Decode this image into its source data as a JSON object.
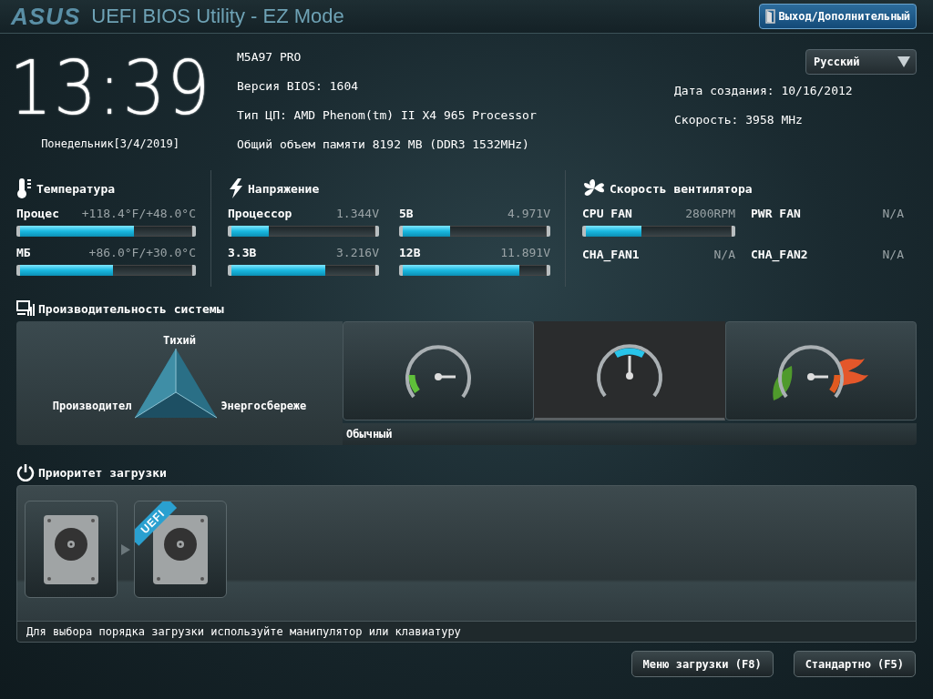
{
  "header": {
    "logo": "ASUS",
    "title": "UEFI BIOS Utility - EZ Mode",
    "exit_button": "Выход/Дополнительный"
  },
  "clock": {
    "time": "13:39",
    "date": "Понедельник[3/4/2019]"
  },
  "system_info": {
    "left": [
      "M5A97 PRO",
      "Версия BIOS: 1604",
      "Тип ЦП: AMD Phenom(tm) II X4 965 Processor",
      "Общий объем памяти 8192 MB (DDR3 1532MHz)"
    ],
    "right": [
      "Дата создания: 10/16/2012",
      "Скорость: 3958 MHz"
    ]
  },
  "language": {
    "value": "Русский"
  },
  "temperature": {
    "title": "Температура",
    "sensors": [
      {
        "name": "Процес",
        "reading": "+118.4°F/+48.0°C",
        "level": 0.66
      },
      {
        "name": "МБ",
        "reading": "+86.0°F/+30.0°C",
        "level": 0.54
      }
    ]
  },
  "voltage": {
    "title": "Напряжение",
    "sensors": [
      {
        "name": "Процессор",
        "reading": "1.344V",
        "level": 0.26
      },
      {
        "name": "5В",
        "reading": "4.971V",
        "level": 0.33
      },
      {
        "name": "3.3В",
        "reading": "3.216V",
        "level": 0.65
      },
      {
        "name": "12В",
        "reading": "11.891V",
        "level": 0.81
      }
    ]
  },
  "fans": {
    "title": "Скорость вентилятора",
    "sensors": [
      {
        "name": "CPU FAN",
        "reading": "2800RPM",
        "level": 0.38
      },
      {
        "name": "PWR FAN",
        "reading": "N/A"
      },
      {
        "name": "CHA_FAN1",
        "reading": "N/A"
      },
      {
        "name": "CHA_FAN2",
        "reading": "N/A"
      }
    ]
  },
  "performance": {
    "title": "Производительность системы",
    "top_label": "Тихий",
    "left_label": "Производител",
    "right_label": "Энергосбереже",
    "modes": [
      {
        "kind": "quiet",
        "selected": false
      },
      {
        "kind": "normal",
        "selected": true
      },
      {
        "kind": "optimal",
        "selected": false
      }
    ],
    "selected_label": "Обычный"
  },
  "boot": {
    "title": "Приоритет загрузки",
    "devices": [
      {
        "kind": "disk"
      },
      {
        "kind": "disk",
        "badge": "UEFI"
      }
    ],
    "hint": "Для выбора порядка загрузки используйте манипулятор или клавиатуру"
  },
  "buttons": [
    "Меню загрузки (F8)",
    "Стандартно (F5)"
  ]
}
